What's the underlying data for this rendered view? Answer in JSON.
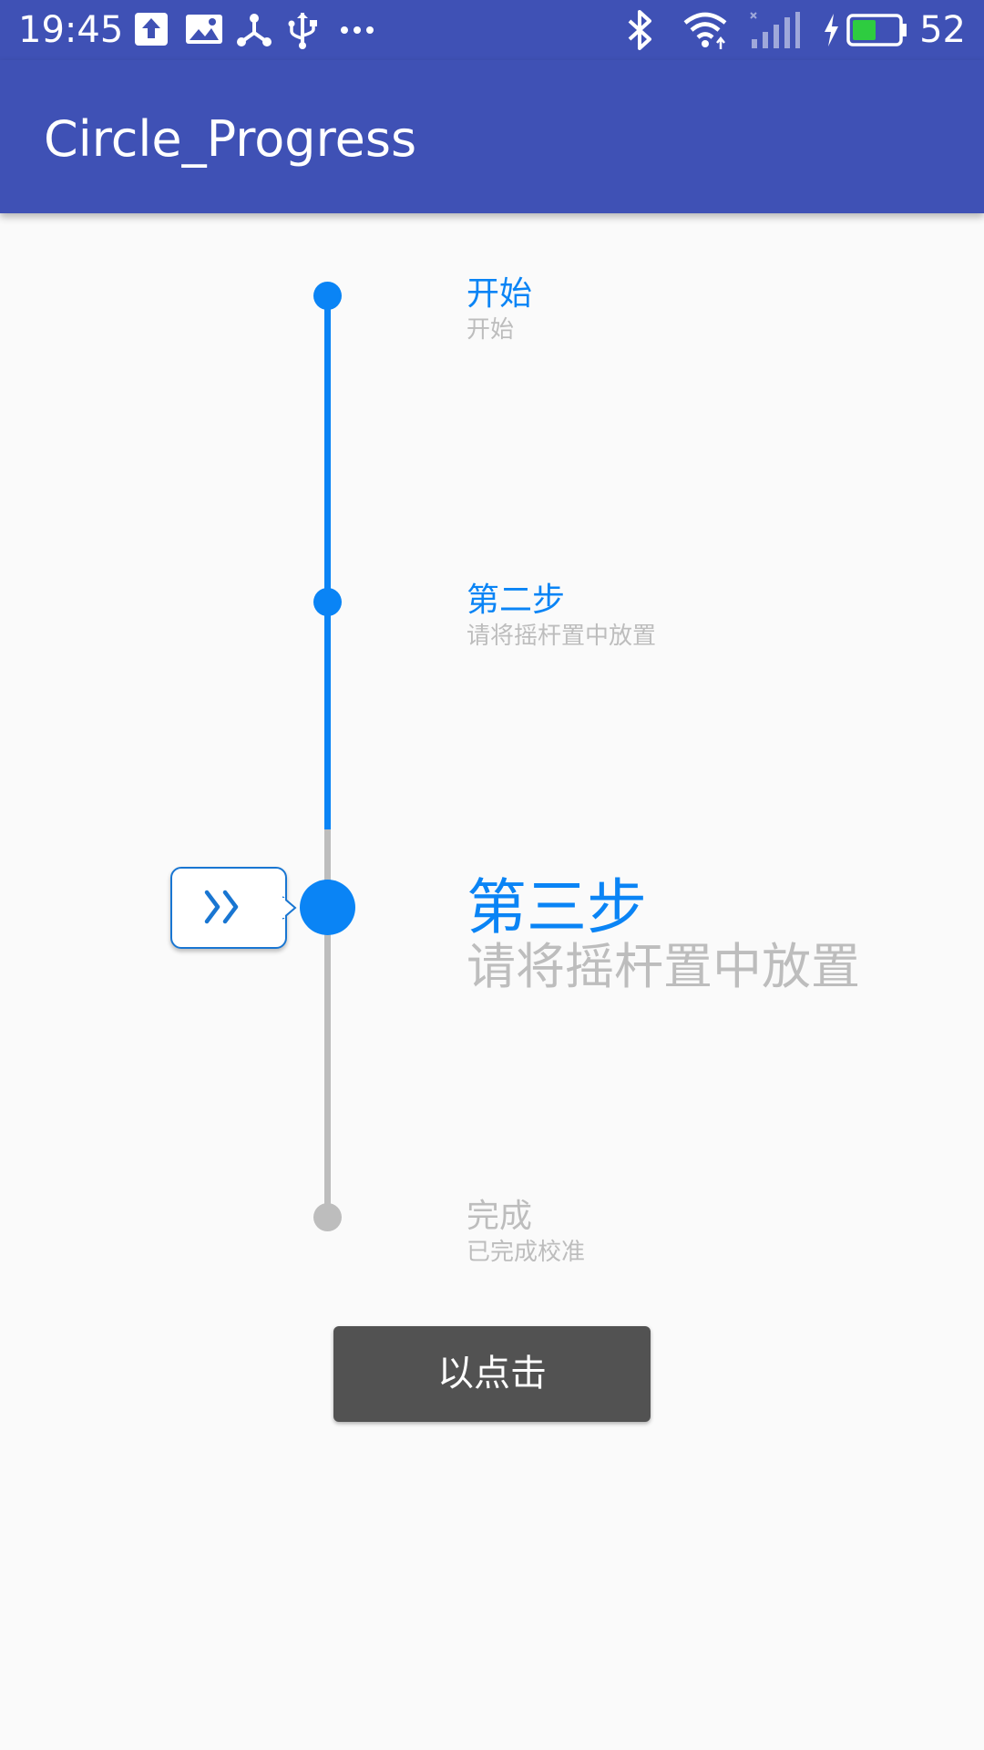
{
  "status_bar": {
    "time": "19:45",
    "battery_percent": "52",
    "left_icons": [
      "upload-icon",
      "image-icon",
      "share-network-icon",
      "usb-icon",
      "more-dots-icon"
    ],
    "right_icons": [
      "bluetooth-icon",
      "wifi-icon",
      "cell-signal-icon",
      "charging-icon",
      "battery-icon"
    ],
    "battery_level": 0.52,
    "battery_color": "#2ECC40"
  },
  "app_bar": {
    "title": "Circle_Progress",
    "color": "#3F51B5"
  },
  "stepper": {
    "active_color": "#0A84F5",
    "inactive_color": "#BDBDBD",
    "current_step_index": 2,
    "steps": [
      {
        "title": "开始",
        "description": "开始",
        "state": "done"
      },
      {
        "title": "第二步",
        "description": "请将摇杆置中放置",
        "state": "done"
      },
      {
        "title": "第三步",
        "description": "请将摇杆置中放置",
        "state": "current"
      },
      {
        "title": "完成",
        "description": "已完成校准",
        "state": "pending"
      }
    ],
    "indicator_icon": "double-chevron-right-icon"
  },
  "action_button": {
    "label": "以点击"
  }
}
